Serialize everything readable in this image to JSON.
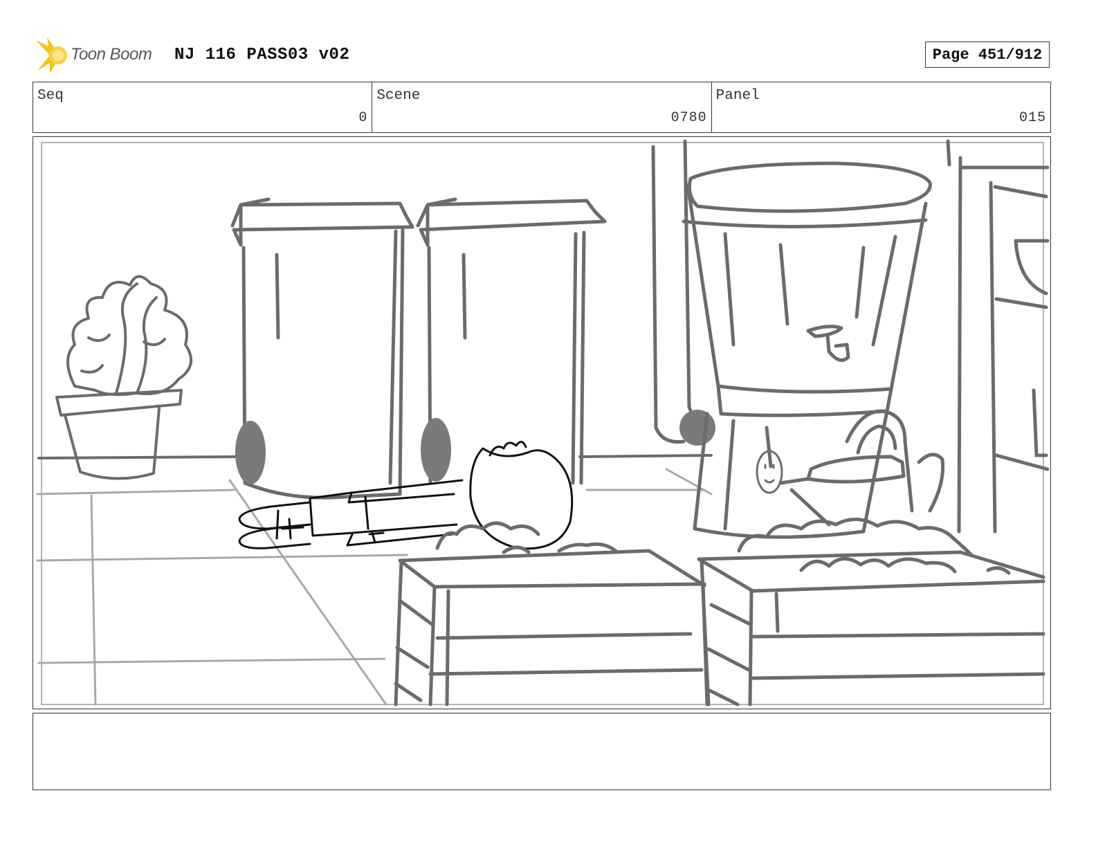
{
  "header": {
    "logo_text": "Toon Boom",
    "title": "NJ 116 PASS03 v02",
    "page_label": "Page 451/912"
  },
  "info": {
    "seq_label": "Seq",
    "seq_value": "0",
    "scene_label": "Scene",
    "scene_value": "0780",
    "panel_label": "Panel",
    "panel_value": "015"
  },
  "notes": {
    "text": ""
  },
  "colors": {
    "sketch_gray": "#6b6b6b",
    "light_gray": "#a8a8a8",
    "fill_gray": "#7a7a7a",
    "logo_yellow": "#f3c417"
  }
}
